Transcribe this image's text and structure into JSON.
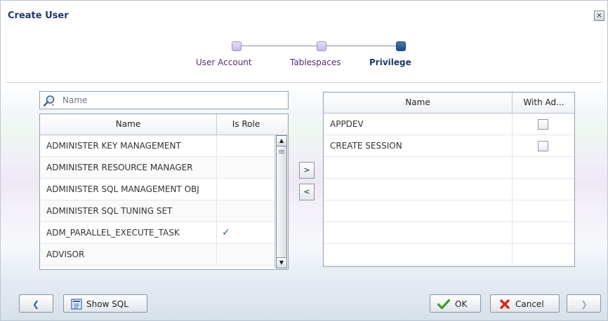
{
  "dialog": {
    "title": "Create User",
    "close_symbol": "×"
  },
  "train": {
    "steps": [
      {
        "label": "User Account",
        "state": "visited"
      },
      {
        "label": "Tablespaces",
        "state": "visited"
      },
      {
        "label": "Privilege",
        "state": "current"
      }
    ]
  },
  "search": {
    "placeholder": "Name",
    "value": ""
  },
  "available_table": {
    "columns": [
      "Name",
      "Is Role"
    ],
    "rows": [
      {
        "name": "ADMINISTER KEY MANAGEMENT",
        "is_role": ""
      },
      {
        "name": "ADMINISTER RESOURCE MANAGER",
        "is_role": ""
      },
      {
        "name": "ADMINISTER SQL MANAGEMENT OBJ",
        "is_role": ""
      },
      {
        "name": "ADMINISTER SQL TUNING SET",
        "is_role": ""
      },
      {
        "name": "ADM_PARALLEL_EXECUTE_TASK",
        "is_role": "✓"
      },
      {
        "name": "ADVISOR",
        "is_role": ""
      }
    ]
  },
  "shuttle": {
    "move_label": ">",
    "remove_label": "<"
  },
  "selected_table": {
    "columns": [
      "Name",
      "With Ad..."
    ],
    "rows": [
      {
        "name": "APPDEV",
        "with_admin": false
      },
      {
        "name": "CREATE SESSION",
        "with_admin": false
      }
    ],
    "empty_rows": 5
  },
  "footer": {
    "back_symbol": "❮",
    "show_sql_label": "Show SQL",
    "ok_label": "OK",
    "cancel_label": "Cancel",
    "next_symbol": "❯"
  },
  "colors": {
    "title": "#1c3a6a",
    "visited_step": "#5a2c72",
    "check_mark": "#2b5ca6",
    "ok_icon": "#3f9b1f",
    "cancel_icon": "#d8261c",
    "back_icon": "#2c5fb0"
  }
}
